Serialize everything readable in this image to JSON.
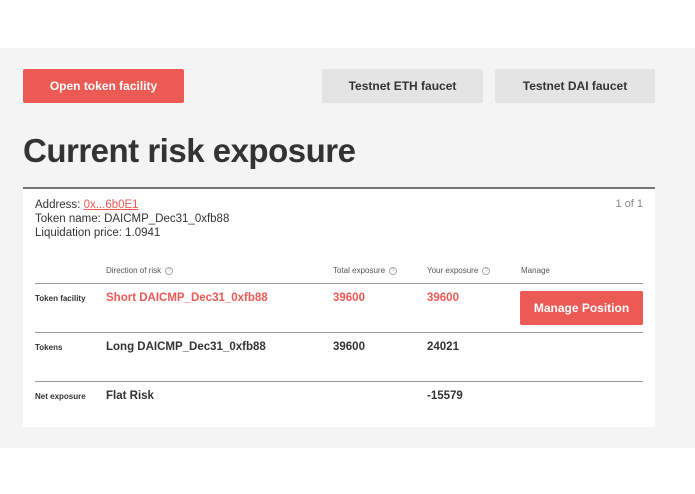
{
  "actions": {
    "open_token_facility": "Open token facility",
    "testnet_eth_faucet": "Testnet ETH faucet",
    "testnet_dai_faucet": "Testnet DAI faucet"
  },
  "page_title": "Current risk exposure",
  "summary": {
    "address_label": "Address:",
    "address_value": "0x...6b0E1",
    "token_name_label": "Token name:",
    "token_name_value": "DAICMP_Dec31_0xfb88",
    "liquidation_label": "Liquidation price:",
    "liquidation_value": "1.0941",
    "pager": "1 of 1"
  },
  "table": {
    "headers": {
      "direction": "Direction of risk",
      "total": "Total exposure",
      "yours": "Your exposure",
      "manage": "Manage"
    },
    "rows": [
      {
        "label": "Token facility",
        "direction": "Short DAICMP_Dec31_0xfb88",
        "total": "39600",
        "yours": "39600",
        "manage": "Manage Position"
      },
      {
        "label": "Tokens",
        "direction": "Long DAICMP_Dec31_0xfb88",
        "total": "39600",
        "yours": "24021"
      },
      {
        "label": "Net exposure",
        "direction": "Flat Risk",
        "total": "",
        "yours": "-15579"
      }
    ]
  },
  "colors": {
    "accent": "#ec5a55",
    "grey_button": "#e4e4e4",
    "background_band": "#f4f4f4"
  },
  "icons": {
    "help": "help-circle-icon"
  }
}
